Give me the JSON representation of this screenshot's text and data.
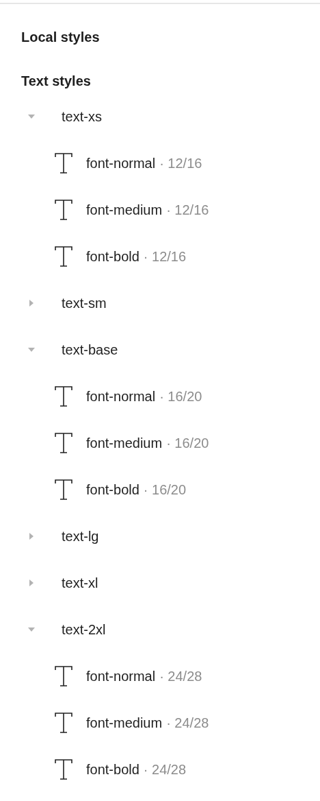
{
  "header": {
    "title": "Local styles"
  },
  "section": {
    "title": "Text styles",
    "groups": [
      {
        "name": "text-xs",
        "expanded": true,
        "children": [
          {
            "name": "font-normal",
            "detail": "· 12/16"
          },
          {
            "name": "font-medium",
            "detail": "· 12/16"
          },
          {
            "name": "font-bold",
            "detail": "· 12/16"
          }
        ]
      },
      {
        "name": "text-sm",
        "expanded": false
      },
      {
        "name": "text-base",
        "expanded": true,
        "children": [
          {
            "name": "font-normal",
            "detail": "· 16/20"
          },
          {
            "name": "font-medium",
            "detail": "· 16/20"
          },
          {
            "name": "font-bold",
            "detail": "· 16/20"
          }
        ]
      },
      {
        "name": "text-lg",
        "expanded": false
      },
      {
        "name": "text-xl",
        "expanded": false
      },
      {
        "name": "text-2xl",
        "expanded": true,
        "children": [
          {
            "name": "font-normal",
            "detail": "· 24/28"
          },
          {
            "name": "font-medium",
            "detail": "· 24/28"
          },
          {
            "name": "font-bold",
            "detail": "· 24/28"
          }
        ]
      }
    ]
  }
}
